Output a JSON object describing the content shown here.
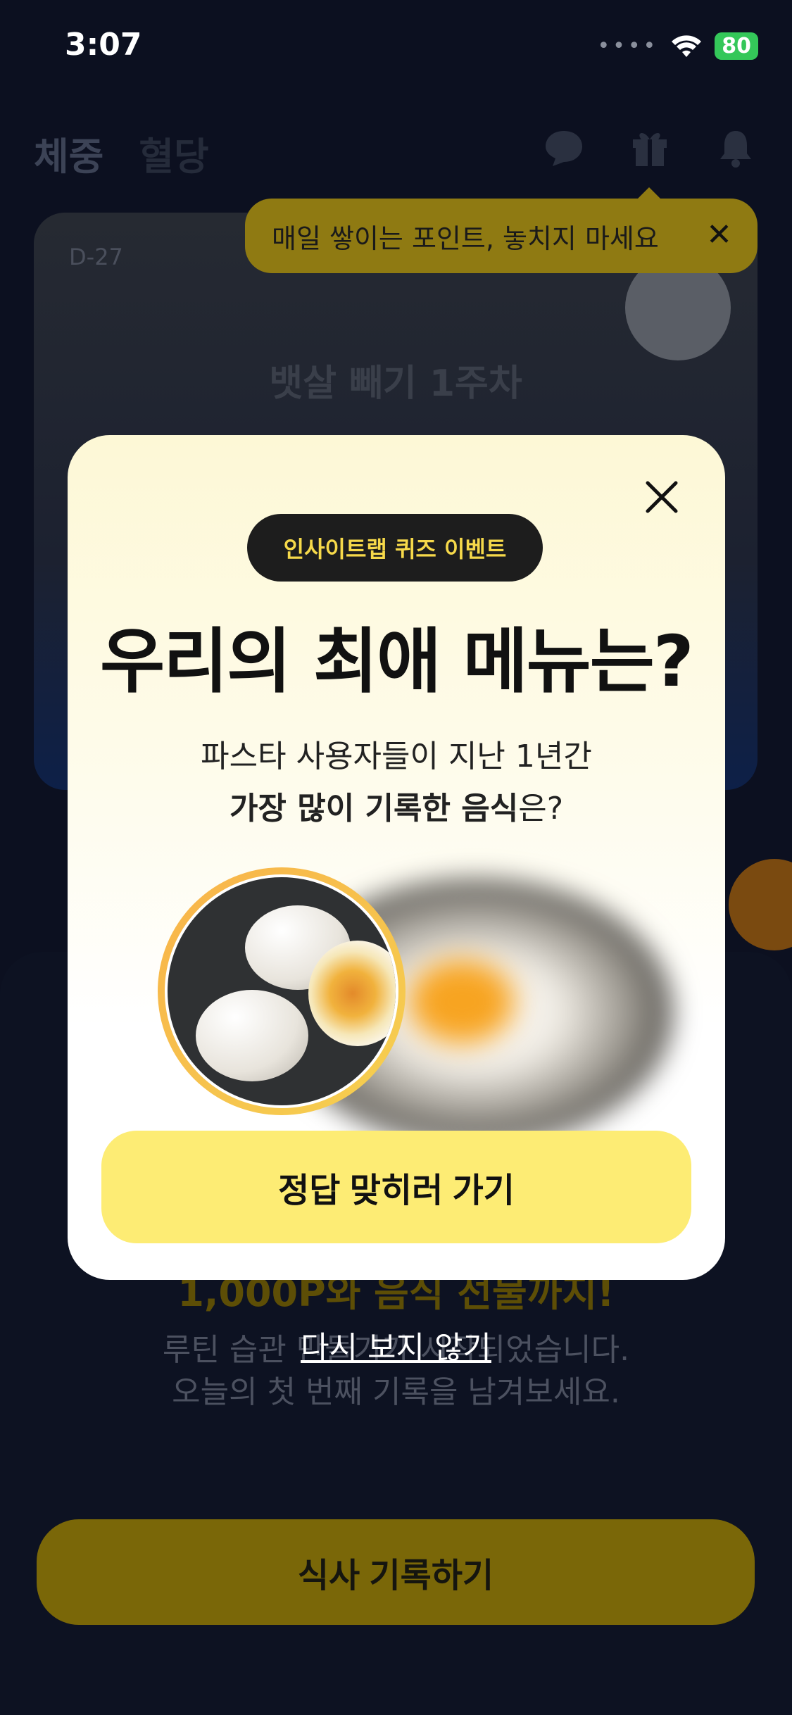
{
  "status": {
    "time": "3:07",
    "battery": "80"
  },
  "header": {
    "tab_weight": "체중",
    "tab_glucose": "혈당"
  },
  "tooltip": {
    "text": "매일 쌓이는 포인트, 놓치지 마세요",
    "close": "✕"
  },
  "hero": {
    "dday": "D-27",
    "title": "뱃살 빼기 1주차"
  },
  "sheet": {
    "highlight": "1,000P와 음식 선물까지!",
    "line1": "루틴 습관 만들기가 시작되었습니다.",
    "line2": "오늘의 첫 번째 기록을 남겨보세요.",
    "record_button": "식사 기록하기"
  },
  "modal": {
    "pill": "인사이트랩 퀴즈 이벤트",
    "title": "우리의 최애 메뉴는?",
    "sub1": "파스타 사용자들이 지난 1년간",
    "sub2_bold": "가장 많이 기록한 음식",
    "sub2_rest": "은?",
    "cta": "정답 맞히러 가기",
    "carousel": {
      "pages": 2,
      "current": 2
    }
  },
  "dont_show": "다시 보지 않기",
  "colors": {
    "accent_yellow": "#fdec74",
    "pill_text": "#f6d94a",
    "background": "#0c1020"
  }
}
